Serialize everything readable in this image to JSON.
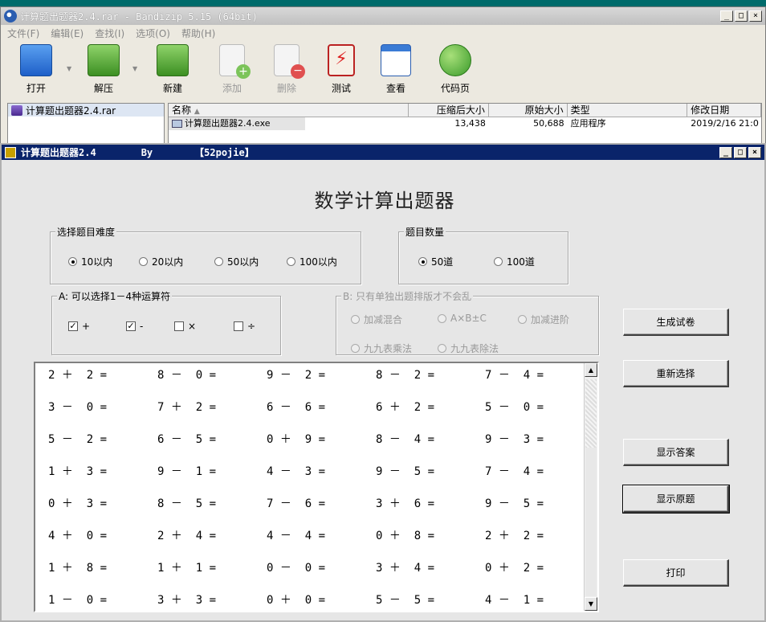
{
  "bandizip": {
    "title": "计算题出题器2.4.rar - Bandizip 5.15 (64bit)",
    "menu": [
      "文件(F)",
      "编辑(E)",
      "查找(I)",
      "选项(O)",
      "帮助(H)"
    ],
    "toolbar": {
      "open": "打开",
      "extract": "解压",
      "new": "新建",
      "add": "添加",
      "delete": "删除",
      "test": "测试",
      "view": "查看",
      "codepage": "代码页"
    },
    "tree_item": "计算题出题器2.4.rar",
    "columns": {
      "name": "名称",
      "compressed": "压缩后大小",
      "original": "原始大小",
      "type": "类型",
      "modified": "修改日期"
    },
    "file": {
      "name": "计算题出题器2.4.exe",
      "compressed": "13,438",
      "original": "50,688",
      "type": "应用程序",
      "modified": "2019/2/16 21:0"
    }
  },
  "calc": {
    "title": "计算题出题器2.4",
    "by": "By",
    "site": "【52pojie】",
    "heading": "数学计算出题器",
    "difficulty": {
      "legend": "选择题目难度",
      "options": [
        "10以内",
        "20以内",
        "50以内",
        "100以内"
      ],
      "selected": "10以内"
    },
    "count": {
      "legend": "题目数量",
      "options": [
        "50道",
        "100道"
      ],
      "selected": "50道"
    },
    "ops": {
      "legend": "A: 可以选择1－4种运算符",
      "items": [
        {
          "label": "+",
          "checked": true
        },
        {
          "label": "-",
          "checked": true
        },
        {
          "label": "×",
          "checked": false
        },
        {
          "label": "÷",
          "checked": false
        }
      ]
    },
    "single": {
      "legend": "B: 只有单独出题排版才不会乱",
      "options": [
        "加减混合",
        "A×B±C",
        "加减进阶",
        "九九表乘法",
        "九九表除法"
      ]
    },
    "buttons": {
      "generate": "生成试卷",
      "reset": "重新选择",
      "show_answers": "显示答案",
      "show_original": "显示原题",
      "print": "打印"
    },
    "problems": [
      [
        "2 ＋  2 =",
        "8 －  0 =",
        "9 －  2 =",
        "8 －  2 =",
        "7 －  4 ="
      ],
      [
        "3 －  0 =",
        "7 ＋  2 =",
        "6 －  6 =",
        "6 ＋  2 =",
        "5 －  0 ="
      ],
      [
        "5 －  2 =",
        "6 －  5 =",
        "0 ＋  9 =",
        "8 －  4 =",
        "9 －  3 ="
      ],
      [
        "1 ＋  3 =",
        "9 －  1 =",
        "4 －  3 =",
        "9 －  5 =",
        "7 －  4 ="
      ],
      [
        "0 ＋  3 =",
        "8 －  5 =",
        "7 －  6 =",
        "3 ＋  6 =",
        "9 －  5 ="
      ],
      [
        "4 ＋  0 =",
        "2 ＋  4 =",
        "4 －  4 =",
        "0 ＋  8 =",
        "2 ＋  2 ="
      ],
      [
        "1 ＋  8 =",
        "1 ＋  1 =",
        "0 －  0 =",
        "3 ＋  4 =",
        "0 ＋  2 ="
      ],
      [
        "1 －  0 =",
        "3 ＋  3 =",
        "0 ＋  0 =",
        "5 －  5 =",
        "4 －  1 ="
      ]
    ]
  }
}
